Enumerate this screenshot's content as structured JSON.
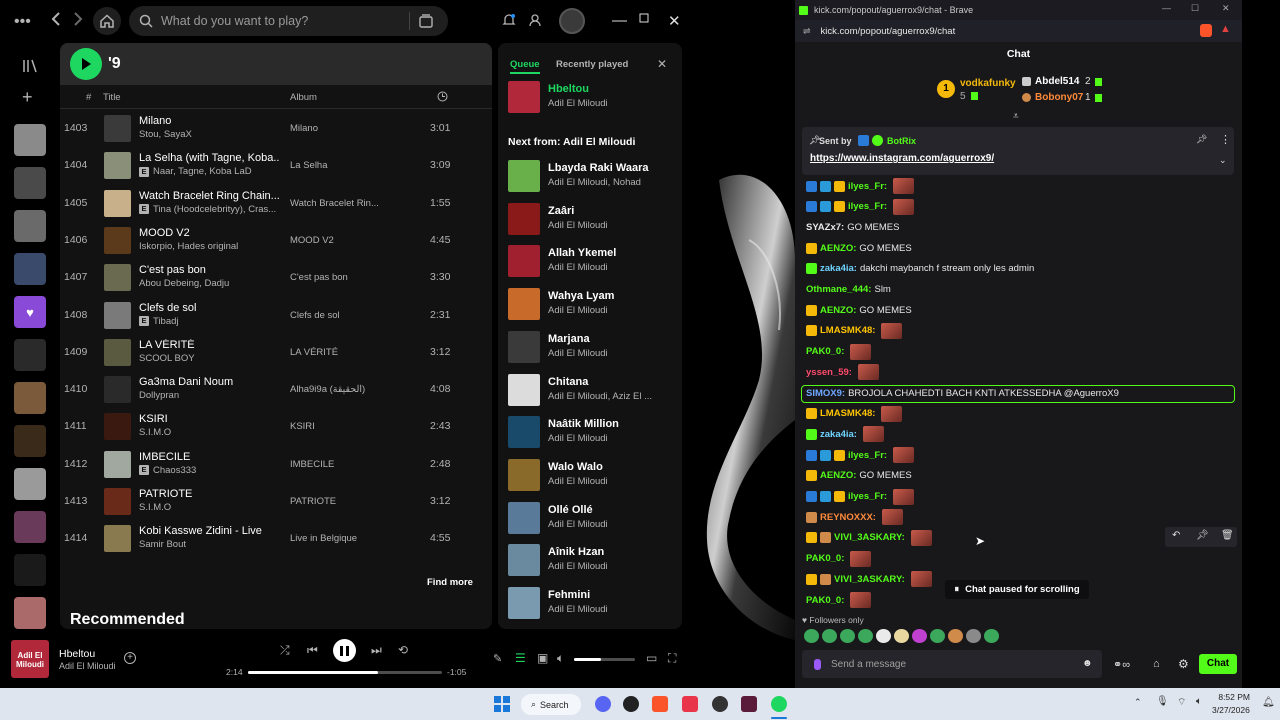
{
  "spotify": {
    "search_placeholder": "What do you want to play?",
    "playlist_title": "'9",
    "columns": {
      "num": "#",
      "title": "Title",
      "album": "Album"
    },
    "tracks": [
      {
        "num": "1403",
        "title": "Milano",
        "artist": "Stou, SayaX",
        "explicit": false,
        "album": "Milano",
        "duration": "3:01",
        "art": "#3a3a3a"
      },
      {
        "num": "1404",
        "title": "La Selha (with Tagne, Koba...",
        "artist": "Naar, Tagne, Koba LaD",
        "explicit": true,
        "album": "La Selha",
        "duration": "3:09",
        "art": "#8a8f7a"
      },
      {
        "num": "1405",
        "title": "Watch Bracelet Ring Chain...",
        "artist": "Tina (Hoodcelebrityy), Cras...",
        "explicit": true,
        "album": "Watch Bracelet Rin...",
        "duration": "1:55",
        "art": "#c8b08a"
      },
      {
        "num": "1406",
        "title": "MOOD V2",
        "artist": "Iskorpio, Hades original",
        "explicit": false,
        "album": "MOOD V2",
        "duration": "4:45",
        "art": "#5a3a1a"
      },
      {
        "num": "1407",
        "title": "C'est pas bon",
        "artist": "Abou Debeing, Dadju",
        "explicit": false,
        "album": "C'est pas bon",
        "duration": "3:30",
        "art": "#6a6a50"
      },
      {
        "num": "1408",
        "title": "Clefs de sol",
        "artist": "Tibadj",
        "explicit": true,
        "album": "Clefs de sol",
        "duration": "2:31",
        "art": "#7a7a7a"
      },
      {
        "num": "1409",
        "title": "LA VÉRITÉ",
        "artist": "SCOOL BOY",
        "explicit": false,
        "album": "LA VÉRITÉ",
        "duration": "3:12",
        "art": "#5a5a40"
      },
      {
        "num": "1410",
        "title": "Ga3ma Dani Noum",
        "artist": "Dollypran",
        "explicit": false,
        "album": "Alha9i9a (الحقيقة)",
        "duration": "4:08",
        "art": "#2a2a2a"
      },
      {
        "num": "1411",
        "title": "KSIRI",
        "artist": "S.I.M.O",
        "explicit": false,
        "album": "KSIRI",
        "duration": "2:43",
        "art": "#3a1a10"
      },
      {
        "num": "1412",
        "title": "IMBECILE",
        "artist": "Chaos333",
        "explicit": true,
        "album": "IMBECILE",
        "duration": "2:48",
        "art": "#a0a8a0"
      },
      {
        "num": "1413",
        "title": "PATRIOTE",
        "artist": "S.I.M.O",
        "explicit": false,
        "album": "PATRIOTE",
        "duration": "3:12",
        "art": "#6a2a1a"
      },
      {
        "num": "1414",
        "title": "Kobi Kasswe Zidini - Live",
        "artist": "Samir Bout",
        "explicit": false,
        "album": "Live in Belgique",
        "duration": "4:55",
        "art": "#8a7a50"
      }
    ],
    "find_more": "Find more",
    "recommended": "Recommended",
    "queue": {
      "tab_queue": "Queue",
      "tab_recent": "Recently played",
      "now_playing": {
        "title": "Hbeltou",
        "artist": "Adil El Miloudi"
      },
      "next_from": "Next from: Adil El Miloudi",
      "items": [
        {
          "title": "Lbayda Raki Waara",
          "artist": "Adil El Miloudi, Nohad",
          "art": "#6ab04a"
        },
        {
          "title": "Zaâri",
          "artist": "Adil El Miloudi",
          "art": "#8a1a1a"
        },
        {
          "title": "Allah Ykemel",
          "artist": "Adil El Miloudi",
          "art": "#a02030"
        },
        {
          "title": "Wahya Lyam",
          "artist": "Adil El Miloudi",
          "art": "#c86a2a"
        },
        {
          "title": "Marjana",
          "artist": "Adil El Miloudi",
          "art": "#3a3a3a"
        },
        {
          "title": "Chitana",
          "artist": "Adil El Miloudi, Aziz El ...",
          "art": "#dcdcdc"
        },
        {
          "title": "Naâtik Million",
          "artist": "Adil El Miloudi",
          "art": "#1a4a6a"
        },
        {
          "title": "Walo Walo",
          "artist": "Adil El Miloudi",
          "art": "#8a6a2a"
        },
        {
          "title": "Ollé Ollé",
          "artist": "Adil El Miloudi",
          "art": "#5a7a9a"
        },
        {
          "title": "Aînik Hzan",
          "artist": "Adil El Miloudi",
          "art": "#6a8aa0"
        },
        {
          "title": "Fehmini",
          "artist": "Adil El Miloudi",
          "art": "#7a9ab0"
        }
      ]
    },
    "player": {
      "art_text": "Adil El Miloudi",
      "title": "Hbeltou",
      "artist": "Adil El Miloudi",
      "elapsed": "2:14",
      "remaining": "-1:05",
      "progress": 0.67,
      "volume": 0.45
    }
  },
  "browser": {
    "tab_title": "kick.com/popout/aguerrox9/chat - Brave",
    "url": "kick.com/popout/aguerrox9/chat"
  },
  "chat": {
    "header": "Chat",
    "leaders": [
      {
        "rank": "1",
        "name": "vodkafunky",
        "count": "5"
      },
      {
        "name": "Abdel514",
        "count": "2"
      },
      {
        "name": "Bobony07",
        "count": "1"
      }
    ],
    "pinned": {
      "sent_by_label": "Sent by",
      "sender": "BotRix",
      "link": "https://www.instagram.com/aguerrox9/"
    },
    "messages": [
      {
        "user": "ilyes_Fr:",
        "color": "#53fc18",
        "text": "",
        "emote": true
      },
      {
        "user": "ilyes_Fr:",
        "color": "#53fc18",
        "text": "",
        "emote": true
      },
      {
        "user": "SYAZx7:",
        "color": "#e8e8e8",
        "text": "GO MEMES",
        "emote": false
      },
      {
        "user": "AENZO:",
        "color": "#53fc18",
        "text": "GO MEMES",
        "emote": false
      },
      {
        "user": "zaka4ia:",
        "color": "#6fd3ff",
        "text": "dakchi maybanch f stream only les admin",
        "emote": false
      },
      {
        "user": "Othmane_444:",
        "color": "#53fc18",
        "text": "Slm",
        "emote": false
      },
      {
        "user": "AENZO:",
        "color": "#53fc18",
        "text": "GO MEMES",
        "emote": false
      },
      {
        "user": "LMASMK48:",
        "color": "#ffc400",
        "text": "",
        "emote": true
      },
      {
        "user": "PAK0_0:",
        "color": "#53fc18",
        "text": "",
        "emote": true
      },
      {
        "user": "yssen_59:",
        "color": "#ff4a6a",
        "text": "",
        "emote": true
      },
      {
        "user": "SIMOX9:",
        "color": "#6fa8ff",
        "text": "BROJOLA CHAHEDTI BACH KNTI ATKESSEDHA @AguerroX9",
        "emote": false
      },
      {
        "user": "LMASMK48:",
        "color": "#ffc400",
        "text": "",
        "emote": true
      },
      {
        "user": "zaka4ia:",
        "color": "#6fd3ff",
        "text": "",
        "emote": true
      },
      {
        "user": "ilyes_Fr:",
        "color": "#53fc18",
        "text": "",
        "emote": true
      },
      {
        "user": "AENZO:",
        "color": "#53fc18",
        "text": "GO MEMES",
        "emote": false
      },
      {
        "user": "ilyes_Fr:",
        "color": "#53fc18",
        "text": "",
        "emote": true
      },
      {
        "user": "REYNOXXX:",
        "color": "#ff8a3a",
        "text": "",
        "emote": true
      },
      {
        "user": "VIVI_3ASKARY:",
        "color": "#53fc18",
        "text": "",
        "emote": true
      },
      {
        "user": "PAK0_0:",
        "color": "#53fc18",
        "text": "",
        "emote": true
      },
      {
        "user": "VIVI_3ASKARY:",
        "color": "#53fc18",
        "text": "",
        "emote": true
      },
      {
        "user": "PAK0_0:",
        "color": "#53fc18",
        "text": "",
        "emote": true
      }
    ],
    "paused": "Chat paused for scrolling",
    "followers_only": "Followers only",
    "input_placeholder": "Send a message",
    "send_label": "Chat"
  },
  "taskbar": {
    "search": "Search",
    "time": "8:52 PM",
    "date": "3/27/2026"
  },
  "colors": {
    "spotify_green": "#1ed760",
    "kick_green": "#53fc18"
  }
}
